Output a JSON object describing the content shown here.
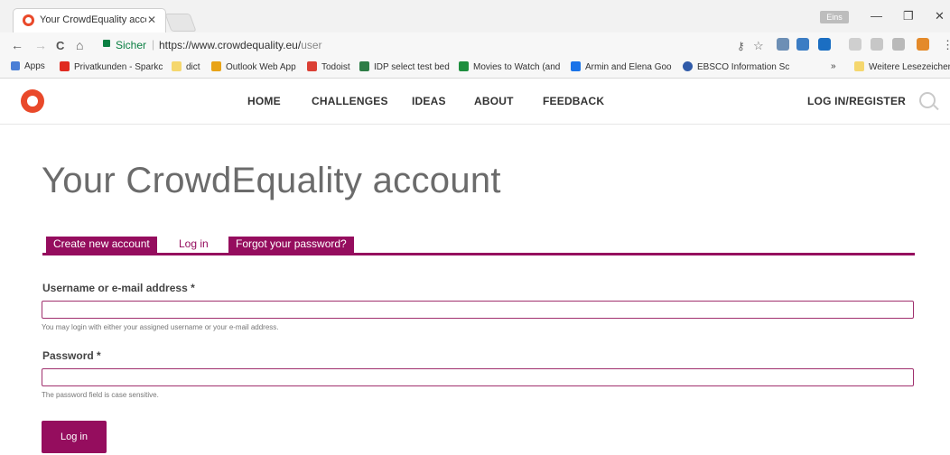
{
  "browser": {
    "tab_title": "Your CrowdEquality acco",
    "tab_close": "✕",
    "window_controls": {
      "user_badge": "Eins",
      "minimize": "—",
      "restore": "❐",
      "close": "✕"
    },
    "nav": {
      "back": "←",
      "forward": "→",
      "reload": "C",
      "home": "⌂"
    },
    "security_label": "Sicher",
    "separator": "|",
    "url_host": "https://www.crowdequality.eu/",
    "url_path": "user"
  },
  "bookmarks": {
    "apps": "Apps",
    "items": [
      {
        "label": "Privatkunden - Sparkc",
        "color": "#e02b20"
      },
      {
        "label": "dict",
        "color": "#f5d76e"
      },
      {
        "label": "Outlook Web App",
        "color": "#e8a317"
      },
      {
        "label": "Todoist",
        "color": "#db4035"
      },
      {
        "label": "IDP select test bed",
        "color": "#2d7d46"
      },
      {
        "label": "Movies to Watch (and",
        "color": "#1e8e3e"
      },
      {
        "label": "Armin and Elena Goo",
        "color": "#1a73e8"
      },
      {
        "label": "EBSCO Information Sc",
        "color": "#2f5aa8"
      }
    ],
    "overflow": "»",
    "other": "Weitere Lesezeichen"
  },
  "site": {
    "brand_color": "#e9492a",
    "accent_color": "#950d5e",
    "nav": [
      "HOME",
      "CHALLENGES",
      "IDEAS",
      "ABOUT",
      "FEEDBACK"
    ],
    "login_register": "LOG IN/REGISTER"
  },
  "page": {
    "title": "Your CrowdEquality account",
    "tabs": [
      "Create new account",
      "Log in",
      "Forgot your password?"
    ],
    "username_label": "Username or e-mail address *",
    "username_value": "",
    "username_hint": "You may login with either your assigned username or your e-mail address.",
    "password_label": "Password *",
    "password_value": "",
    "password_hint": "The password field is case sensitive.",
    "submit": "Log in"
  }
}
